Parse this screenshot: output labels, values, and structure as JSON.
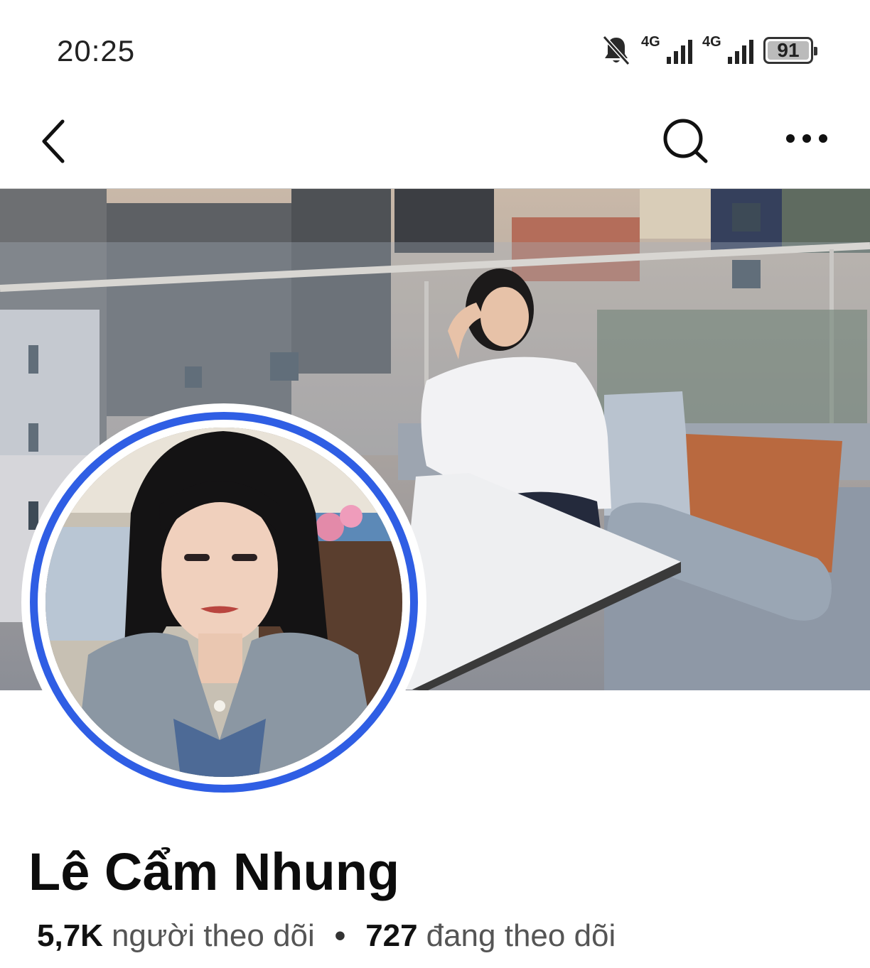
{
  "status_bar": {
    "time": "20:25",
    "icons": [
      "bell-muted-icon",
      "network-4g-icon",
      "network-4g-icon",
      "battery-icon"
    ],
    "network_labels": [
      "4G",
      "4G"
    ],
    "battery_percent": "91"
  },
  "app_bar": {
    "back_icon": "chevron-left-icon",
    "search_icon": "search-icon",
    "more_icon": "more-horizontal-icon"
  },
  "profile": {
    "name": "Lê Cẩm Nhung",
    "followers_count": "5,7K",
    "followers_label": "người theo dõi",
    "separator": "•",
    "following_count": "727",
    "following_label": "đang theo dõi"
  },
  "colors": {
    "avatar_ring": "#2f5ee4",
    "text_primary": "#0c0c0c",
    "text_secondary": "#555555"
  }
}
